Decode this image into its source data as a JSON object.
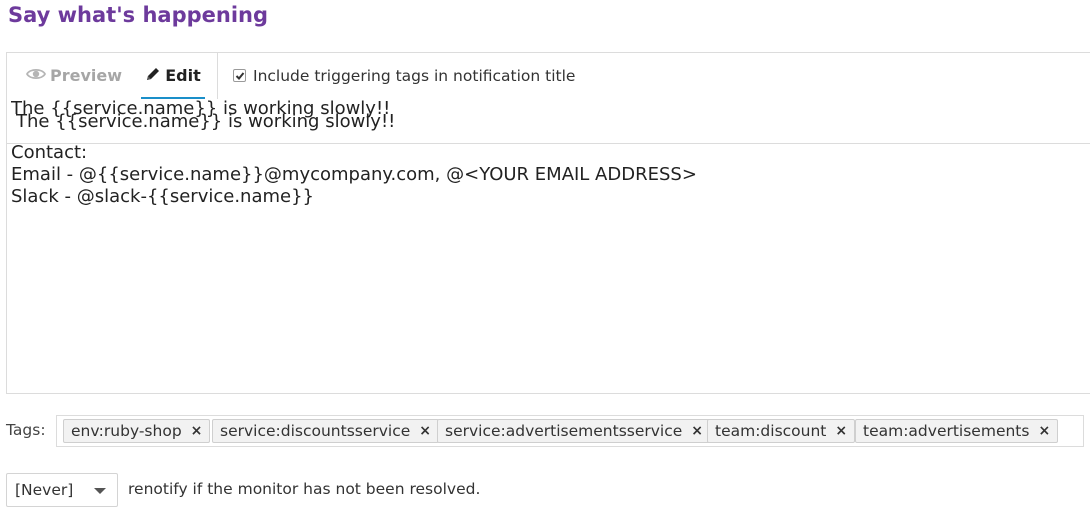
{
  "section_title": "Say what's happening",
  "tabs": {
    "preview_label": "Preview",
    "edit_label": "Edit",
    "preview_icon": "eye-icon",
    "edit_icon": "pencil-icon"
  },
  "include_tags": {
    "label": "Include triggering tags in notification title",
    "checked": true
  },
  "subject": "The {{service.name}} is working slowly!!",
  "message": "The {{service.name}} is working slowly!!\n\nContact:\nEmail - @{{service.name}}@mycompany.com, @<YOUR EMAIL ADDRESS>\nSlack - @slack-{{service.name}}",
  "tags": {
    "label": "Tags:",
    "items": [
      "env:ruby-shop",
      "service:discountsservice",
      "service:advertisementsservice",
      "team:discount",
      "team:advertisements"
    ],
    "remove_glyph": "×"
  },
  "renotify": {
    "selected": "[Never]",
    "text": "renotify if the monitor has not been resolved."
  },
  "colors": {
    "title": "#6d3a9c",
    "active_tab_underline": "#1a8fc9"
  }
}
